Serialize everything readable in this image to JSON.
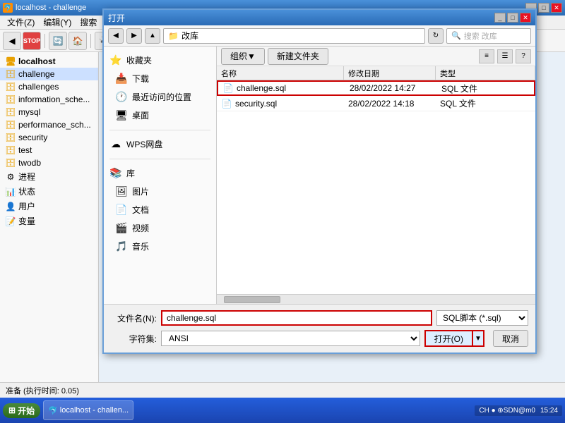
{
  "app": {
    "title": "localhost - challenge",
    "status": "准备  (执行时间: 0.05)"
  },
  "menu": {
    "items": [
      "文件(Z)",
      "编辑(Y)",
      "搜索"
    ]
  },
  "sidebar": {
    "items": [
      {
        "label": "localhost",
        "type": "server",
        "level": 0
      },
      {
        "label": "challenge",
        "type": "db",
        "level": 1,
        "selected": true
      },
      {
        "label": "challenges",
        "type": "db",
        "level": 1
      },
      {
        "label": "information_sche...",
        "type": "db",
        "level": 1
      },
      {
        "label": "mysql",
        "type": "db",
        "level": 1
      },
      {
        "label": "performance_sch...",
        "type": "db",
        "level": 1
      },
      {
        "label": "security",
        "type": "db",
        "level": 1
      },
      {
        "label": "test",
        "type": "db",
        "level": 1
      },
      {
        "label": "twodb",
        "type": "db",
        "level": 1
      },
      {
        "label": "进程",
        "type": "sys",
        "level": 0
      },
      {
        "label": "状态",
        "type": "sys",
        "level": 0
      },
      {
        "label": "用户",
        "type": "sys",
        "level": 0
      },
      {
        "label": "变量",
        "type": "sys",
        "level": 0
      }
    ]
  },
  "dialog": {
    "title": "打开",
    "path": "改库",
    "search_placeholder": "搜索 改库",
    "left_nav": [
      {
        "label": "收藏夹",
        "icon": "⭐",
        "type": "header"
      },
      {
        "label": "下载",
        "icon": "📥",
        "type": "item"
      },
      {
        "label": "最近访问的位置",
        "icon": "🕐",
        "type": "item"
      },
      {
        "label": "桌面",
        "icon": "🖥️",
        "type": "item"
      },
      {
        "label": "WPS网盘",
        "icon": "☁",
        "type": "item"
      },
      {
        "label": "库",
        "icon": "📚",
        "type": "header"
      },
      {
        "label": "图片",
        "icon": "🖼",
        "type": "item"
      },
      {
        "label": "文档",
        "icon": "📄",
        "type": "item"
      },
      {
        "label": "视频",
        "icon": "🎬",
        "type": "item"
      },
      {
        "label": "音乐",
        "icon": "🎵",
        "type": "item"
      }
    ],
    "toolbar": {
      "organize": "组织▼",
      "new_folder": "新建文件夹"
    },
    "columns": {
      "name": "名称",
      "date": "修改日期",
      "type": "类型"
    },
    "files": [
      {
        "name": "challenge.sql",
        "date": "28/02/2022 14:27",
        "type": "SQL 文件",
        "selected": true,
        "icon": "📄"
      },
      {
        "name": "security.sql",
        "date": "28/02/2022 14:18",
        "type": "SQL 文件",
        "selected": false,
        "icon": "📄"
      }
    ],
    "footer": {
      "filename_label": "文件名(N):",
      "filename_value": "challenge.sql",
      "charset_label": "字符集:",
      "charset_value": "ANSI",
      "filetype": "SQL脚本 (*.sql)",
      "open_btn": "打开(O)",
      "cancel_btn": "取消"
    }
  },
  "taskbar": {
    "start": "开始",
    "items": [
      "localhost - challen..."
    ],
    "tray": "CH ● ⊕SDN@m0",
    "time": "15:24"
  }
}
